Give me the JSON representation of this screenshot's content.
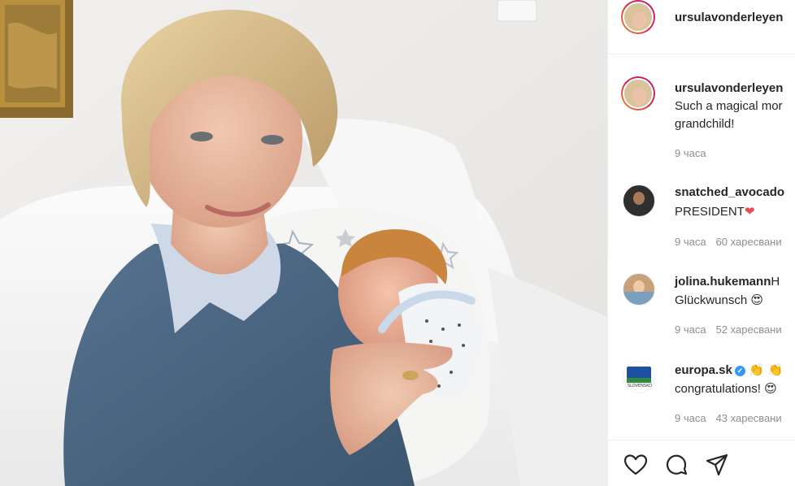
{
  "post": {
    "author": "ursulavonderleyen",
    "caption_line1": "Such a magical mor",
    "caption_line2": "grandchild!",
    "time": "9 часа"
  },
  "comments": [
    {
      "user": "snatched_avocado",
      "text": "PRESIDENT",
      "emoji": "❤",
      "time": "9 часа",
      "likes": "60 харесвани"
    },
    {
      "user": "jolina.hukemann",
      "user_suffix": "H",
      "text": "Glückwunsch",
      "emoji": "😍",
      "time": "9 часа",
      "likes": "52 харесвани"
    },
    {
      "user": "europa.sk",
      "verified_mark": "✓",
      "user_suffix": "👏 👏",
      "text": "congratulations!",
      "emoji": "😍",
      "time": "9 часа",
      "likes": "43 харесвани",
      "avatar_label": "SLOVENSKO"
    }
  ],
  "colors": {
    "accent_blue": "#3897f0",
    "heart_red": "#ed4956",
    "border": "#efefef",
    "muted": "#8e8e8e",
    "text": "#262626"
  },
  "icons": [
    "heart-icon",
    "comment-icon",
    "share-icon",
    "verified-icon"
  ]
}
